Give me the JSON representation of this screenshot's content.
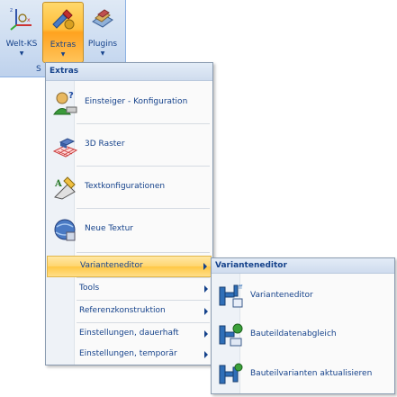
{
  "ribbon": {
    "buttons": [
      {
        "label": "Welt-KS",
        "icon": "coordinate-system-icon"
      },
      {
        "label": "Extras",
        "icon": "extras-icon",
        "active": true
      },
      {
        "label": "Plugins",
        "icon": "plugins-icon"
      }
    ],
    "group_fragment": "S"
  },
  "menu": {
    "header": "Extras",
    "big_items": [
      {
        "label": "Einsteiger - Konfiguration",
        "icon": "beginner-config-icon"
      },
      {
        "label": "3D Raster",
        "icon": "3d-grid-icon"
      },
      {
        "label": "Textkonfigurationen",
        "icon": "text-config-icon"
      },
      {
        "label": "Neue Textur",
        "icon": "new-texture-icon"
      }
    ],
    "small_items": [
      {
        "label": "Varianteneditor",
        "submenu": true,
        "highlighted": true
      },
      {
        "label": "Tools",
        "submenu": true
      },
      {
        "label": "Referenzkonstruktion",
        "submenu": true
      },
      {
        "label": "Einstellungen, dauerhaft",
        "submenu": true
      },
      {
        "label": "Einstellungen, temporär",
        "submenu": true
      }
    ]
  },
  "submenu": {
    "header": "Varianteneditor",
    "items": [
      {
        "label": "Varianteneditor",
        "icon": "variant-editor-icon"
      },
      {
        "label": "Bauteildatenabgleich",
        "icon": "part-data-sync-icon"
      },
      {
        "label": "Bauteilvarianten aktualisieren",
        "icon": "update-part-variants-icon"
      }
    ]
  },
  "colors": {
    "accent_text": "#15428b",
    "highlight": "#ffd56f",
    "menu_header_bg": "#dbe6f4"
  }
}
